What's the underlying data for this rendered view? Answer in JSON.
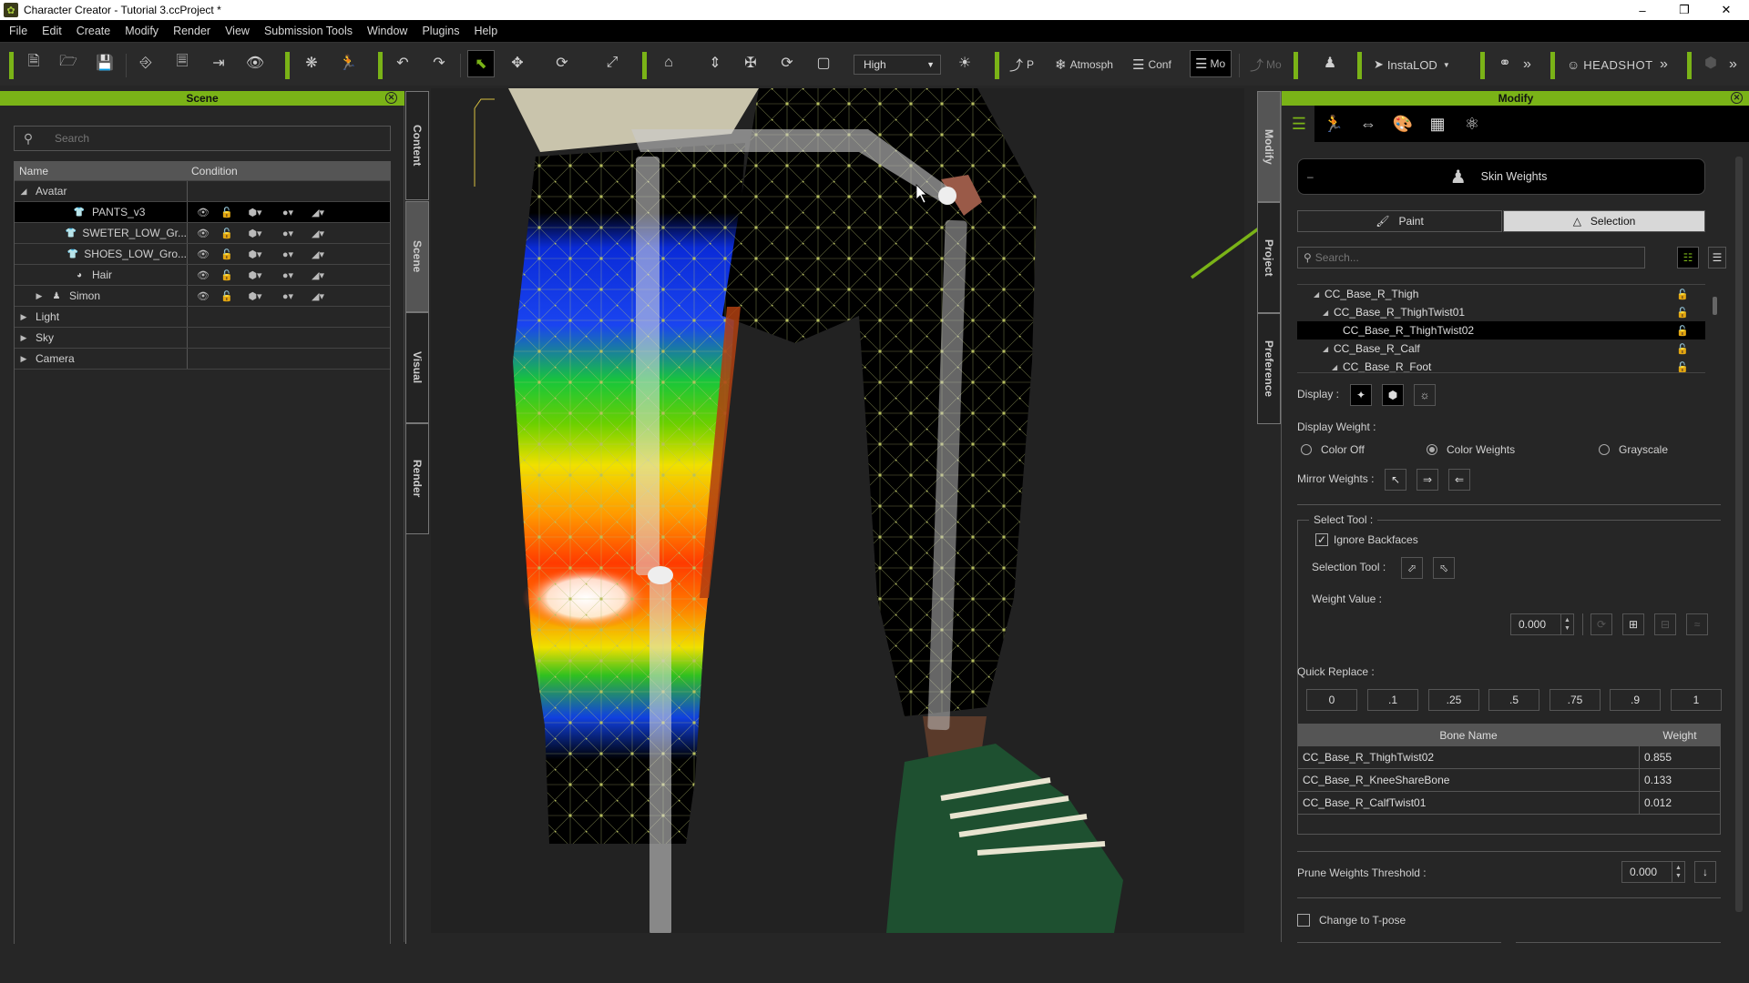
{
  "window": {
    "title": "Character Creator - Tutorial 3.ccProject *",
    "controls": [
      "minimize",
      "restore",
      "close"
    ]
  },
  "menu": [
    "File",
    "Edit",
    "Create",
    "Modify",
    "Render",
    "View",
    "Submission Tools",
    "Window",
    "Plugins",
    "Help"
  ],
  "toolbar": {
    "file_icons": [
      "new-file-icon",
      "open-folder-icon",
      "save-icon",
      "import-avatar-icon",
      "export-ic-icon",
      "export-icon",
      "preview-icon"
    ],
    "quality_select": "High",
    "labels": {
      "pose": "P",
      "atmosphere": "Atmosph",
      "conform": "Conf",
      "modify": "Mo",
      "motion": "Mo",
      "instalod": "InstaLOD",
      "headshot": "HEADSHOT"
    },
    "accent": "#7ab317"
  },
  "scene_panel": {
    "title": "Scene",
    "search_placeholder": "Search",
    "columns": [
      "Name",
      "Condition"
    ],
    "rows": [
      {
        "name": "Avatar",
        "level": 0,
        "expand": "open",
        "icon": "",
        "has_condition": false,
        "selected": false
      },
      {
        "name": "PANTS_v3",
        "level": 2,
        "expand": "",
        "icon": "cloth-icon",
        "has_condition": true,
        "selected": true
      },
      {
        "name": "SWETER_LOW_Gr...",
        "level": 2,
        "expand": "",
        "icon": "cloth-icon",
        "has_condition": true,
        "selected": false
      },
      {
        "name": "SHOES_LOW_Gro...",
        "level": 2,
        "expand": "",
        "icon": "cloth-icon",
        "has_condition": true,
        "selected": false
      },
      {
        "name": "Hair",
        "level": 2,
        "expand": "",
        "icon": "hair-icon",
        "has_condition": true,
        "selected": false
      },
      {
        "name": "Simon",
        "level": 1,
        "expand": "closed",
        "icon": "person-icon",
        "has_condition": true,
        "selected": false
      },
      {
        "name": "Light",
        "level": 0,
        "expand": "closed",
        "icon": "",
        "has_condition": false,
        "selected": false
      },
      {
        "name": "Sky",
        "level": 0,
        "expand": "closed",
        "icon": "",
        "has_condition": false,
        "selected": false
      },
      {
        "name": "Camera",
        "level": 0,
        "expand": "closed",
        "icon": "",
        "has_condition": false,
        "selected": false
      }
    ]
  },
  "left_tabs": [
    {
      "label": "Content",
      "active": false
    },
    {
      "label": "Scene",
      "active": true
    },
    {
      "label": "Visual",
      "active": false
    },
    {
      "label": "Render",
      "active": false
    }
  ],
  "right_tabs": [
    {
      "label": "Modify",
      "active": true
    },
    {
      "label": "Project",
      "active": false
    },
    {
      "label": "Preference",
      "active": false
    }
  ],
  "modify_panel": {
    "title": "Modify",
    "tab_icons": [
      "sliders-icon",
      "pose-icon",
      "morph-icon",
      "material-icon",
      "checker-texture-icon",
      "physics-atom-icon"
    ],
    "section_title": "Skin Weights",
    "collapse_symbol": "–",
    "mode_tabs": [
      {
        "label": "Paint",
        "icon": "brush-icon",
        "active": false
      },
      {
        "label": "Selection",
        "icon": "triangle-vertices-icon",
        "active": true
      }
    ],
    "bone_search_placeholder": "Search...",
    "bones": [
      {
        "name": "CC_Base_R_Thigh",
        "indent": 1,
        "expand": true,
        "selected": false
      },
      {
        "name": "CC_Base_R_ThighTwist01",
        "indent": 2,
        "expand": true,
        "selected": false
      },
      {
        "name": "CC_Base_R_ThighTwist02",
        "indent": 3,
        "expand": false,
        "selected": true
      },
      {
        "name": "CC_Base_R_Calf",
        "indent": 2,
        "expand": true,
        "selected": false
      },
      {
        "name": "CC_Base_R_Foot",
        "indent": 3,
        "expand": true,
        "selected": false
      }
    ],
    "display_label": "Display :",
    "display_weight_label": "Display Weight :",
    "display_weight_options": [
      {
        "label": "Color Off",
        "checked": false
      },
      {
        "label": "Color Weights",
        "checked": true
      },
      {
        "label": "Grayscale",
        "checked": false
      }
    ],
    "mirror_weights_label": "Mirror Weights :",
    "select_tool_label": "Select Tool :",
    "ignore_backfaces_label": "Ignore Backfaces",
    "ignore_backfaces_checked": true,
    "selection_tool_label": "Selection Tool :",
    "weight_value_label": "Weight Value :",
    "weight_value": "0.000",
    "quick_replace_label": "Quick Replace :",
    "quick_replace_values": [
      "0",
      ".1",
      ".25",
      ".5",
      ".75",
      ".9",
      "1"
    ],
    "highlighted_quick_replace": ".9",
    "weight_table": {
      "columns": [
        "Bone Name",
        "Weight"
      ],
      "rows": [
        {
          "bone": "CC_Base_R_ThighTwist02",
          "weight": "0.855"
        },
        {
          "bone": "CC_Base_R_KneeShareBone",
          "weight": "0.133"
        },
        {
          "bone": "CC_Base_R_CalfTwist01",
          "weight": "0.012"
        }
      ]
    },
    "prune_label": "Prune Weights Threshold :",
    "prune_value": "0.000",
    "tpose_label": "Change to T-pose",
    "tpose_checked": false
  }
}
